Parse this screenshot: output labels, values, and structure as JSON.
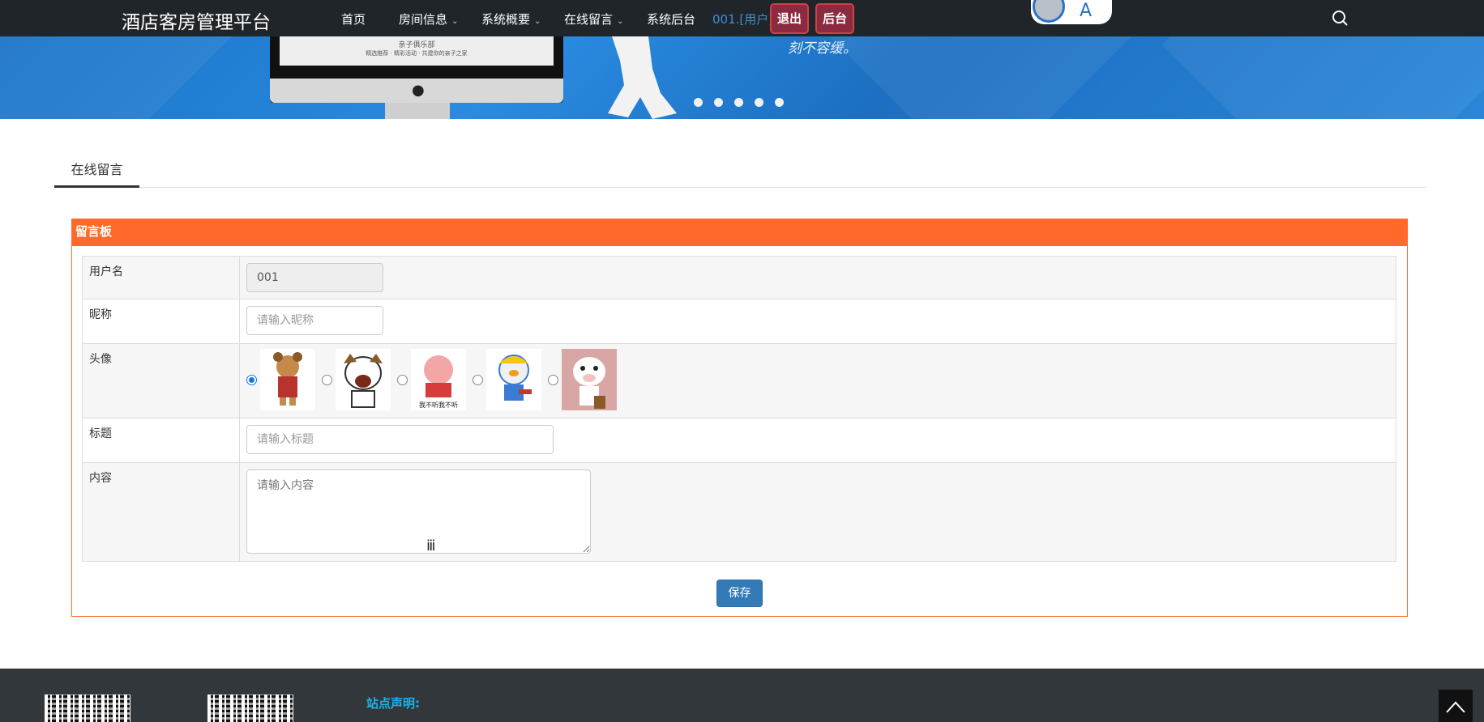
{
  "nav": {
    "brand": "酒店客房管理平台",
    "items": [
      {
        "label": "首页",
        "dropdown": false
      },
      {
        "label": "房间信息",
        "dropdown": true
      },
      {
        "label": "系统概要",
        "dropdown": true
      },
      {
        "label": "在线留言",
        "dropdown": true
      },
      {
        "label": "系统后台",
        "dropdown": false
      }
    ],
    "user": "001.[用户]",
    "logout": "退出",
    "admin": "后台"
  },
  "banner": {
    "slogan": "刻不容缓。",
    "screen_title": "亲子俱乐部",
    "screen_sub": "精选推荐 · 精彩活动 · 共建你的亲子之家",
    "slide_count": 5,
    "badge_letter": "A"
  },
  "tabs": [
    "在线留言"
  ],
  "form": {
    "title": "留言板",
    "fields": {
      "username": {
        "label": "用户名",
        "value": "001"
      },
      "nickname": {
        "label": "昵称",
        "placeholder": "请输入昵称"
      },
      "avatar": {
        "label": "头像",
        "selected_index": 0,
        "options": [
          "avatar-1",
          "avatar-2",
          "avatar-3",
          "avatar-4",
          "avatar-5"
        ],
        "caption_3": "我不听我不听"
      },
      "subject": {
        "label": "标题",
        "placeholder": "请输入标题"
      },
      "content": {
        "label": "内容",
        "placeholder": "请输入内容"
      }
    },
    "save": "保存"
  },
  "footer": {
    "title": "站点声明:"
  },
  "colors": {
    "nav_bg": "#1f2528",
    "panel_accent": "#ff6a2b",
    "primary_button": "#337ab7",
    "footer_bg": "#32373b",
    "footer_heading": "#1bb3e8"
  }
}
